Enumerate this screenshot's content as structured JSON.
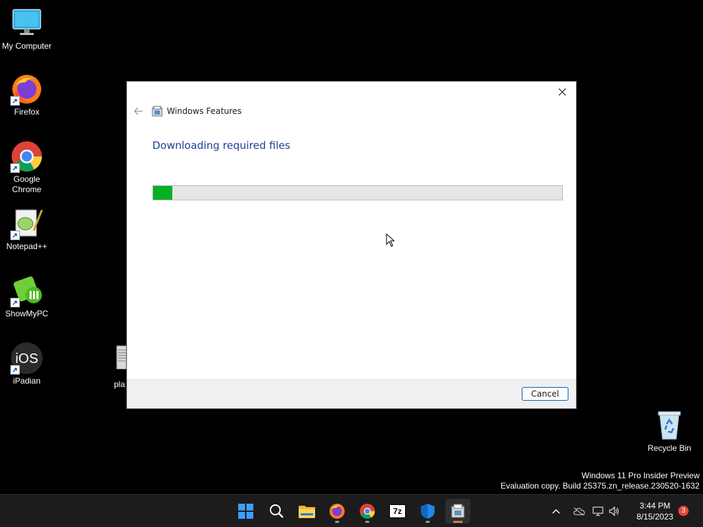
{
  "desktop": {
    "icons": [
      {
        "label": "My Computer",
        "icon": "computer-icon"
      },
      {
        "label": "Firefox",
        "icon": "firefox-icon"
      },
      {
        "label": "Google Chrome",
        "icon": "chrome-icon"
      },
      {
        "label": "Notepad++",
        "icon": "notepadpp-icon"
      },
      {
        "label": "ShowMyPC",
        "icon": "showmypc-icon"
      },
      {
        "label": "iPadian",
        "icon": "ipadian-icon"
      },
      {
        "label": "Recycle Bin",
        "icon": "recycle-bin-icon"
      }
    ],
    "partial_label": "pla",
    "ios_text": "iOS"
  },
  "dialog": {
    "nav_title": "Windows Features",
    "heading": "Downloading required files",
    "progress": 0.047,
    "cancel_label": "Cancel",
    "accent": "#1c3f94",
    "progress_color": "#06b025"
  },
  "watermark": {
    "line1": "Windows 11 Pro Insider Preview",
    "line2": "Evaluation copy. Build 25375.zn_release.230520-1632"
  },
  "taskbar": {
    "apps": [
      {
        "name": "start-button",
        "icon": "windows-icon"
      },
      {
        "name": "search-button",
        "icon": "search-icon"
      },
      {
        "name": "file-explorer",
        "icon": "folder-icon"
      },
      {
        "name": "firefox",
        "icon": "firefox-icon"
      },
      {
        "name": "chrome",
        "icon": "chrome-icon"
      },
      {
        "name": "7zip",
        "icon": "7zip-icon",
        "text": "7z"
      },
      {
        "name": "defender",
        "icon": "shield-icon"
      },
      {
        "name": "windows-features",
        "icon": "windows-features-icon"
      }
    ],
    "time": "3:44 PM",
    "date": "8/15/2023",
    "notification_count": "3"
  }
}
